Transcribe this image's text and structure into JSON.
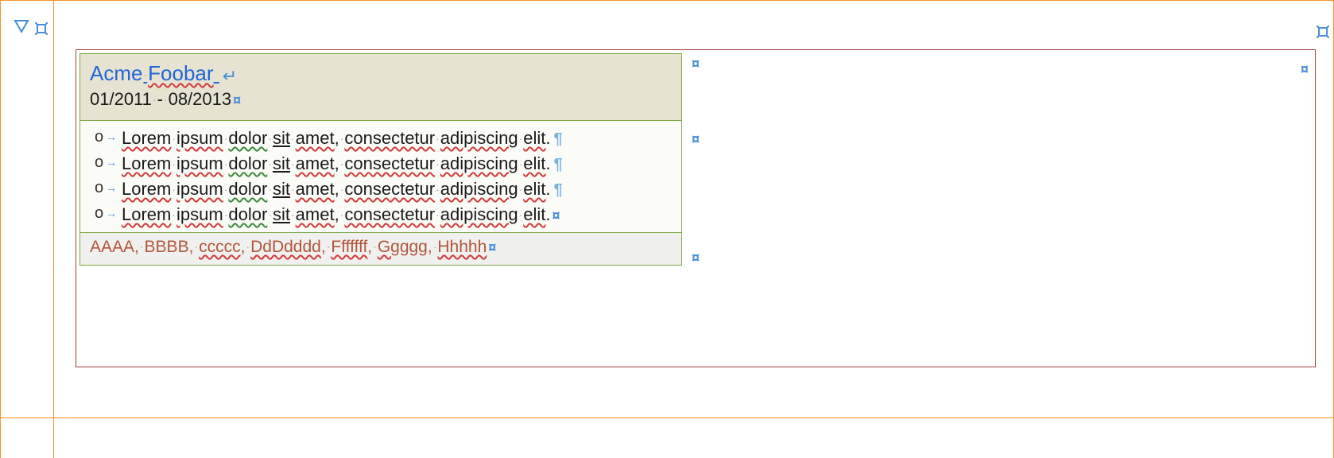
{
  "header": {
    "company": "Acme Foobar",
    "date_range": "01/2011 - 08/2013"
  },
  "bullets": [
    "Lorem ipsum dolor sit amet, consectetur adipiscing elit.",
    "Lorem ipsum dolor sit amet, consectetur adipiscing elit.",
    "Lorem ipsum dolor sit amet, consectetur adipiscing elit.",
    "Lorem ipsum dolor sit amet, consectetur adipiscing elit."
  ],
  "tags_text": "AAAA, BBBB, ccccc, DdDdddd, Fffffff, Ggggg, Hhhhh",
  "spellcheck": {
    "red_words": [
      "Foobar",
      "Lorem",
      "ipsum",
      "amet",
      "consectetur",
      "adipiscing",
      "elit",
      "ccccc",
      "DdDdddd",
      "Fffffff",
      "Ggggg",
      "Hhhhh"
    ],
    "green_words": [
      "dolor"
    ],
    "underline_words": [
      "sit"
    ]
  },
  "marks": {
    "cell_end": "¤",
    "line_break": "↵",
    "pilcrow": "¶",
    "space_dot": "·",
    "tab_arrow": "→",
    "collapse": "▽"
  }
}
